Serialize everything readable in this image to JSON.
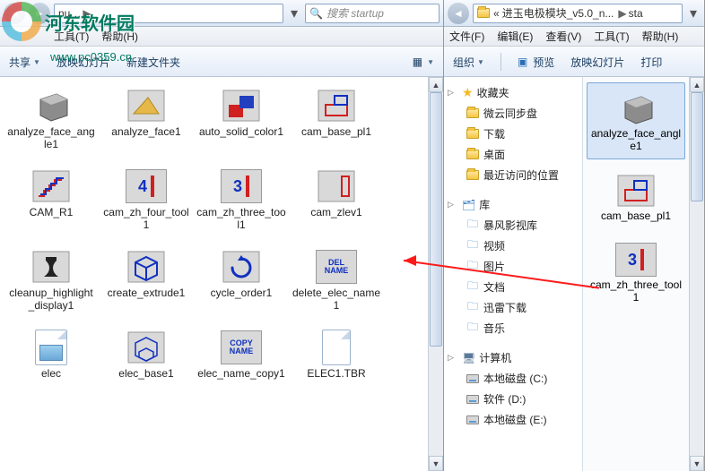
{
  "watermark": {
    "site_name": "河东软件园",
    "url": "www.pc0359.cn"
  },
  "left": {
    "address": {
      "segment": "nu…",
      "crumb": "▶",
      "suffix": "▶"
    },
    "search_placeholder": "搜索 startup",
    "menu": {
      "file": "工具(T)",
      "help": "帮助(H)"
    },
    "cmd": {
      "share": "共享",
      "slideshow": "放映幻灯片",
      "newfolder": "新建文件夹"
    },
    "files": [
      {
        "id": "analyze_face_angle1",
        "label": "analyze_face_angle1",
        "icon": "cube-gray"
      },
      {
        "id": "analyze_face1",
        "label": "analyze_face1",
        "icon": "wedge-yellow"
      },
      {
        "id": "auto_solid_color1",
        "label": "auto_solid_color1",
        "icon": "blocks-rb"
      },
      {
        "id": "cam_base_pl1",
        "label": "cam_base_pl1",
        "icon": "step-red"
      },
      {
        "id": "CAM_R1",
        "label": "CAM_R1",
        "icon": "stair-redblue"
      },
      {
        "id": "cam_zh_four_tool1",
        "label": "cam_zh_four_tool1",
        "icon": "num4"
      },
      {
        "id": "cam_zh_three_tool1",
        "label": "cam_zh_three_tool1",
        "icon": "num3"
      },
      {
        "id": "cam_zlev1",
        "label": "cam_zlev1",
        "icon": "bar-red"
      },
      {
        "id": "cleanup_highlight_display1",
        "label": "cleanup_highlight_display1",
        "icon": "vase-black"
      },
      {
        "id": "create_extrude1",
        "label": "create_extrude1",
        "icon": "cube-blue"
      },
      {
        "id": "cycle_order1",
        "label": "cycle_order1",
        "icon": "swirl-blue"
      },
      {
        "id": "delete_elec_name1",
        "label": "delete_elec_name1",
        "icon": "text-del",
        "text": "DEL\nNAME"
      },
      {
        "id": "elec",
        "label": "elec",
        "icon": "doc-image"
      },
      {
        "id": "elec_base1",
        "label": "elec_base1",
        "icon": "wire-blue"
      },
      {
        "id": "elec_name_copy1",
        "label": "elec_name_copy1",
        "icon": "text-copy",
        "text": "COPY\nNAME"
      },
      {
        "id": "ELEC1_TBR",
        "label": "ELEC1.TBR",
        "icon": "doc-plain"
      }
    ]
  },
  "right": {
    "address": {
      "prefix": "«",
      "seg1": "进玉电极模块_v5.0_n...",
      "seg2": "sta"
    },
    "menu": {
      "file": "文件(F)",
      "edit": "编辑(E)",
      "view": "查看(V)",
      "tools": "工具(T)",
      "help": "帮助(H)"
    },
    "cmd": {
      "organize": "组织",
      "preview": "预览",
      "slideshow": "放映幻灯片",
      "print": "打印"
    },
    "sidebar": {
      "favorites": {
        "title": "收藏夹",
        "items": [
          "微云同步盘",
          "下载",
          "桌面",
          "最近访问的位置"
        ]
      },
      "libraries": {
        "title": "库",
        "items": [
          "暴风影视库",
          "视频",
          "图片",
          "文档",
          "迅雷下载",
          "音乐"
        ]
      },
      "computer": {
        "title": "计算机",
        "items": [
          "本地磁盘 (C:)",
          "软件 (D:)",
          "本地磁盘 (E:)"
        ]
      }
    },
    "files": [
      {
        "id": "analyze_face_angle1",
        "label": "analyze_face_angle1",
        "icon": "cube-gray",
        "selected": true
      },
      {
        "id": "cam_base_pl1",
        "label": "cam_base_pl1",
        "icon": "step-red"
      },
      {
        "id": "cam_zh_three_tool1",
        "label": "cam_zh_three_tool1",
        "icon": "num3"
      }
    ]
  }
}
